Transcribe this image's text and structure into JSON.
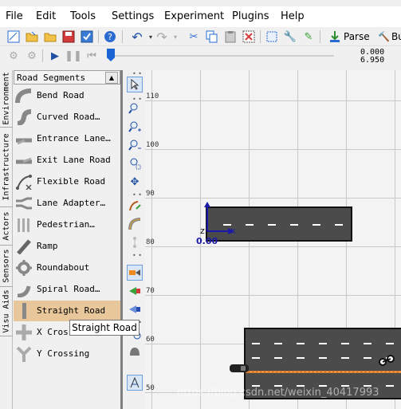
{
  "menubar": {
    "items": [
      "File",
      "Edit",
      "Tools",
      "Settings",
      "Experiment",
      "Plugins",
      "Help"
    ]
  },
  "toolbar": {
    "parse_label": "Parse",
    "bu_label": "Bu"
  },
  "timeline": {
    "value_top": "0.000",
    "value_bottom": "6.950"
  },
  "side_tabs": [
    "Environment",
    "Infrastructure",
    "Actors",
    "Sensors",
    "Visu Aids"
  ],
  "palette": {
    "header": "Road Segments",
    "items": [
      "Bend Road",
      "Curved Road…",
      "Entrance Lane…",
      "Exit Lane Road",
      "Flexible Road",
      "Lane Adapter…",
      "Pedestrian…",
      "Ramp",
      "Roundabout",
      "Spiral Road…",
      "Straight Road",
      "X Cross",
      "Y Crossing"
    ],
    "selected": "Straight Road"
  },
  "tooltip": "Straight Road",
  "canvas": {
    "y_labels": [
      "110",
      "100",
      "90",
      "80",
      "70",
      "60",
      "50"
    ],
    "axis_z": "z",
    "axis_x": "x",
    "origin_value": "0.00"
  },
  "watermark": "https://blog.csdn.net/weixin_40417993",
  "colors": {
    "road": "#4b4b4b",
    "selection": "#e8c79a",
    "axis": "#1a1aa8",
    "accent": "#1a64d4"
  }
}
